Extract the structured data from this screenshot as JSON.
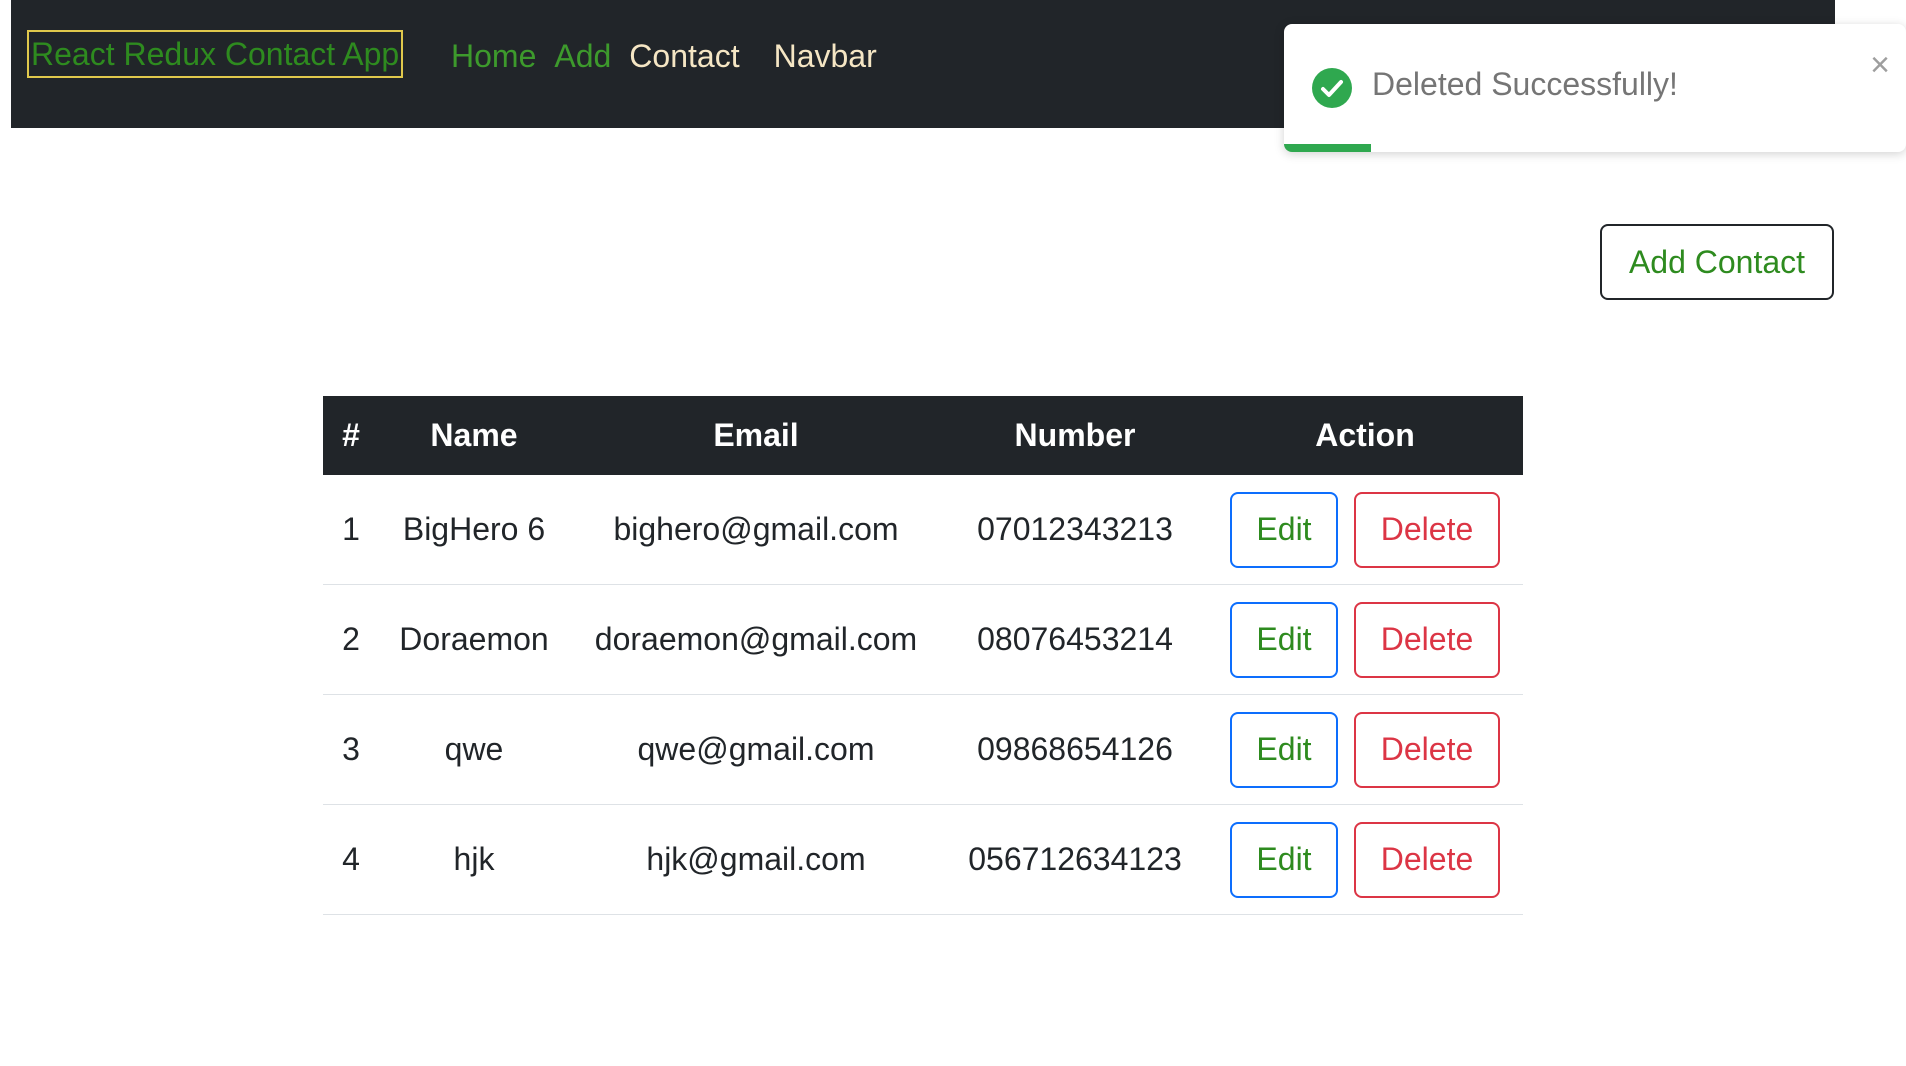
{
  "navbar": {
    "brand": "React Redux Contact App",
    "links": [
      "Home",
      "Add",
      "Contact"
    ],
    "label": "Navbar"
  },
  "toast": {
    "message": "Deleted Successfully!",
    "close_symbol": "×",
    "icon": "check-circle-icon",
    "progress_fraction": 0.14,
    "color": "#2fa84f"
  },
  "add_contact_label": "Add Contact",
  "table": {
    "headers": [
      "#",
      "Name",
      "Email",
      "Number",
      "Action"
    ],
    "rows": [
      {
        "index": "1",
        "name": "BigHero 6",
        "email": "bighero@gmail.com",
        "number": "07012343213"
      },
      {
        "index": "2",
        "name": "Doraemon",
        "email": "doraemon@gmail.com",
        "number": "08076453214"
      },
      {
        "index": "3",
        "name": "qwe",
        "email": "qwe@gmail.com",
        "number": "09868654126"
      },
      {
        "index": "4",
        "name": "hjk",
        "email": "hjk@gmail.com",
        "number": "056712634123"
      }
    ],
    "edit_label": "Edit",
    "delete_label": "Delete"
  },
  "colors": {
    "navbar_bg": "#212529",
    "brand_border": "#e0c84c",
    "link_green": "#3d9a2c",
    "link_cream": "#f5e6c4",
    "edit_border": "#0d6efd",
    "delete_red": "#dc3545"
  }
}
